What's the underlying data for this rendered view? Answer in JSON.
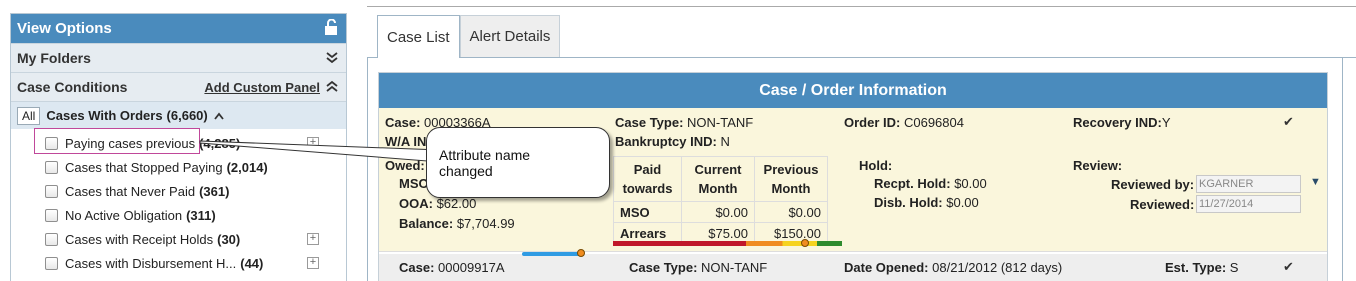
{
  "left_panel": {
    "title": "View Options",
    "my_folders": "My Folders",
    "case_conditions": "Case Conditions",
    "add_custom_panel": "Add Custom Panel",
    "all_button": "All",
    "group_label": "Cases With Orders",
    "group_count": "(6,660)",
    "items": [
      {
        "label": "Paying cases previous",
        "count": "(4,285)",
        "has_plus": true
      },
      {
        "label": "Cases that Stopped Paying",
        "count": "(2,014)",
        "has_plus": false
      },
      {
        "label": "Cases that Never Paid",
        "count": "(361)",
        "has_plus": false
      },
      {
        "label": "No Active Obligation",
        "count": "(311)",
        "has_plus": false
      },
      {
        "label": "Cases with Receipt Holds",
        "count": "(30)",
        "has_plus": true
      },
      {
        "label": "Cases with Disbursement H...",
        "count": "(44)",
        "has_plus": true
      }
    ]
  },
  "callout": {
    "line1": "Attribute name",
    "line2": "changed"
  },
  "tabs": [
    "Case List",
    "Alert Details"
  ],
  "case_info": {
    "header": "Case / Order Information",
    "case1": {
      "case_label": "Case:",
      "case_value": "00003366A",
      "wa_label": "W/A IN",
      "case_type_label": "Case Type:",
      "case_type_value": "NON-TANF",
      "bankruptcy_label": "Bankruptcy IND:",
      "bankruptcy_value": "N",
      "order_id_label": "Order ID:",
      "order_id_value": "C0696804",
      "recovery_label": "Recovery IND:",
      "recovery_value": "Y",
      "owed_label": "Owed:",
      "mso_label": "MSO",
      "ooa_label": "OOA:",
      "ooa_value": "$62.00",
      "balance_label": "Balance:",
      "balance_value": "$7,704.99",
      "table": {
        "headers": [
          "Paid towards",
          "Current Month",
          "Previous Month"
        ],
        "rows": [
          {
            "name": "MSO",
            "current": "$0.00",
            "previous": "$0.00"
          },
          {
            "name": "Arrears",
            "current": "$75.00",
            "previous": "$150.00"
          }
        ]
      },
      "hold_label": "Hold:",
      "recpt_hold_label": "Recpt. Hold:",
      "recpt_hold_value": "$0.00",
      "disb_hold_label": "Disb. Hold:",
      "disb_hold_value": "$0.00",
      "review_label": "Review:",
      "reviewed_by_label": "Reviewed by:",
      "reviewed_by_value": "KGARNER",
      "reviewed_label": "Reviewed:",
      "reviewed_value": "11/27/2014",
      "check": "✔"
    },
    "case2": {
      "case_label": "Case:",
      "case_value": "00009917A",
      "case_type_label": "Case Type:",
      "case_type_value": "NON-TANF",
      "date_opened_label": "Date Opened:",
      "date_opened_value": "08/21/2012 (812 days)",
      "est_type_label": "Est. Type:",
      "est_type_value": "S",
      "check": "✔"
    }
  },
  "colors": {
    "header_blue": "#4a8bbd",
    "case_bg": "#faf6dc",
    "highlight": "#c0479a"
  }
}
